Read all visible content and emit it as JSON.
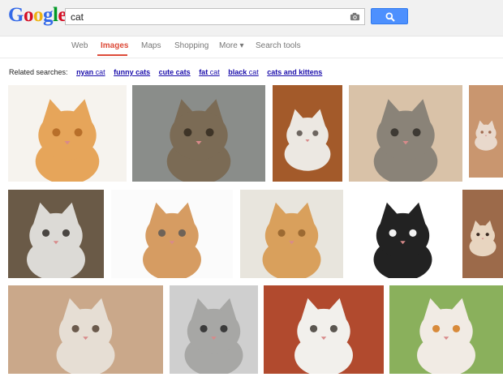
{
  "header": {
    "logo_letters": [
      "G",
      "o",
      "o",
      "g",
      "l",
      "e"
    ],
    "logo_colors": [
      "#3369e8",
      "#d50f25",
      "#eeb211",
      "#3369e8",
      "#009925",
      "#d50f25"
    ],
    "search_value": "cat",
    "camera_icon": "camera-icon",
    "search_icon": "magnifier-icon",
    "button_color": "#4d90fe"
  },
  "tabs": [
    {
      "label": "Web",
      "active": false
    },
    {
      "label": "Images",
      "active": true
    },
    {
      "label": "Maps",
      "active": false
    },
    {
      "label": "Shopping",
      "active": false
    },
    {
      "label": "More ▾",
      "active": false
    },
    {
      "label": "Search tools",
      "active": false
    }
  ],
  "related": {
    "label": "Related searches:",
    "links": [
      {
        "bold": "nyan",
        "rest": " cat"
      },
      {
        "bold": "funny cats",
        "rest": ""
      },
      {
        "bold": "cute cats",
        "rest": ""
      },
      {
        "bold": "fat",
        "rest": " cat"
      },
      {
        "bold": "black",
        "rest": " cat"
      },
      {
        "bold": "cats and kittens",
        "rest": ""
      }
    ]
  },
  "images": [
    {
      "alt": "orange tabby cat sitting",
      "bg": "#f6f3ee",
      "fur": "#e6a55a",
      "dark": "#b86f2a"
    },
    {
      "alt": "tabby cat on road",
      "bg": "#8a8d8a",
      "fur": "#7b6b55",
      "dark": "#3e3427"
    },
    {
      "alt": "grumpy cat with santa hat",
      "bg": "#a35a2a",
      "fur": "#ece8e2",
      "dark": "#6d6660"
    },
    {
      "alt": "gray tabby cat held",
      "bg": "#d9c2a8",
      "fur": "#8a8378",
      "dark": "#3e3a34"
    },
    {
      "alt": "partial cat image",
      "bg": "#c9966f",
      "fur": "#e9d9cc",
      "dark": "#a06b50"
    },
    {
      "alt": "white and gray cat closeup",
      "bg": "#6a5a47",
      "fur": "#dcdad6",
      "dark": "#4a4642"
    },
    {
      "alt": "two kittens tabby and orange",
      "bg": "#fbfbfb",
      "fur": "#d69c62",
      "dark": "#6e6358"
    },
    {
      "alt": "orange kitten face",
      "bg": "#e8e5dd",
      "fur": "#d9a05c",
      "dark": "#9c6a32"
    },
    {
      "alt": "black and white kitten lying",
      "bg": "#ffffff",
      "fur": "#222222",
      "dark": "#f2f2f2"
    },
    {
      "alt": "siamese cat partial",
      "bg": "#9c6a4a",
      "fur": "#e8d5c0",
      "dark": "#3a2a22"
    },
    {
      "alt": "grumpy cat face",
      "bg": "#caa88a",
      "fur": "#e6ded4",
      "dark": "#6b5a4c"
    },
    {
      "alt": "tabby cat with bell collar",
      "bg": "#cfcfcf",
      "fur": "#a7a7a5",
      "dark": "#3b3b3b"
    },
    {
      "alt": "gray and white kitten",
      "bg": "#b14a2e",
      "fur": "#f2f0ec",
      "dark": "#5b5650"
    },
    {
      "alt": "calico kitten",
      "bg": "#8ab05c",
      "fur": "#f1ebe4",
      "dark": "#d88a3a"
    }
  ]
}
